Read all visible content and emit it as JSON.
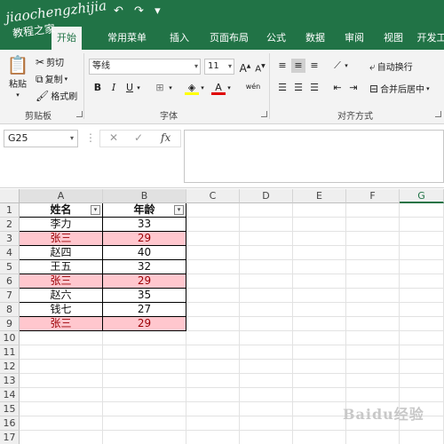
{
  "watermark": {
    "text": "jiaochengzhijia",
    "sub": "教程之家"
  },
  "qat": {
    "undo": "↶",
    "redo": "↷",
    "customize": "▾"
  },
  "tabs": [
    {
      "label": "开始",
      "active": true
    },
    {
      "label": "常用菜单"
    },
    {
      "label": "插入"
    },
    {
      "label": "页面布局"
    },
    {
      "label": "公式"
    },
    {
      "label": "数据"
    },
    {
      "label": "审阅"
    },
    {
      "label": "视图"
    },
    {
      "label": "开发工"
    }
  ],
  "ribbon": {
    "clipboard": {
      "paste": "粘贴",
      "cut": "剪切",
      "copy": "复制",
      "format_painter": "格式刷",
      "label": "剪贴板"
    },
    "font": {
      "name": "等线",
      "size": "11",
      "grow": "A",
      "shrink": "A",
      "bold": "B",
      "italic": "I",
      "underline": "U",
      "phonetic": "wén",
      "label": "字体"
    },
    "alignment": {
      "wrap": "自动换行",
      "merge": "合并后居中",
      "label": "对齐方式"
    }
  },
  "formula_bar": {
    "name_box": "G25",
    "fx": "fx",
    "cancel": "✕",
    "confirm": "✓",
    "value": ""
  },
  "columns": [
    "A",
    "B",
    "C",
    "D",
    "E",
    "F",
    "G"
  ],
  "rows": [
    "1",
    "2",
    "3",
    "4",
    "5",
    "6",
    "7",
    "8",
    "9",
    "10",
    "11",
    "12",
    "13",
    "14",
    "15",
    "16",
    "17"
  ],
  "table": {
    "headers": [
      "姓名",
      "年龄"
    ],
    "data": [
      {
        "name": "李力",
        "age": "33",
        "highlight": false
      },
      {
        "name": "张三",
        "age": "29",
        "highlight": true
      },
      {
        "name": "赵四",
        "age": "40",
        "highlight": false
      },
      {
        "name": "王五",
        "age": "32",
        "highlight": false
      },
      {
        "name": "张三",
        "age": "29",
        "highlight": true
      },
      {
        "name": "赵六",
        "age": "35",
        "highlight": false
      },
      {
        "name": "钱七",
        "age": "27",
        "highlight": false
      },
      {
        "name": "张三",
        "age": "29",
        "highlight": true
      }
    ]
  },
  "colors": {
    "accent": "#217346",
    "highlight_fill": "#ffc7ce",
    "highlight_text": "#9c0006"
  },
  "baidu_watermark": "Baidu经验"
}
